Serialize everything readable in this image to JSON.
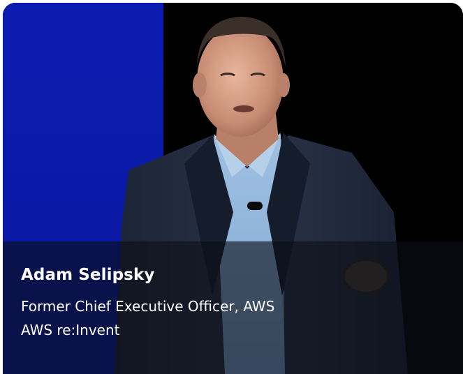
{
  "speaker_card": {
    "name": "Adam Selipsky",
    "title": "Former Chief Executive Officer, AWS",
    "event": "AWS re:Invent"
  },
  "colors": {
    "stage_blue": "#0a1aa8",
    "stage_black": "#000000",
    "caption_overlay": "rgba(12,14,22,0.62)",
    "text": "#ffffff"
  }
}
